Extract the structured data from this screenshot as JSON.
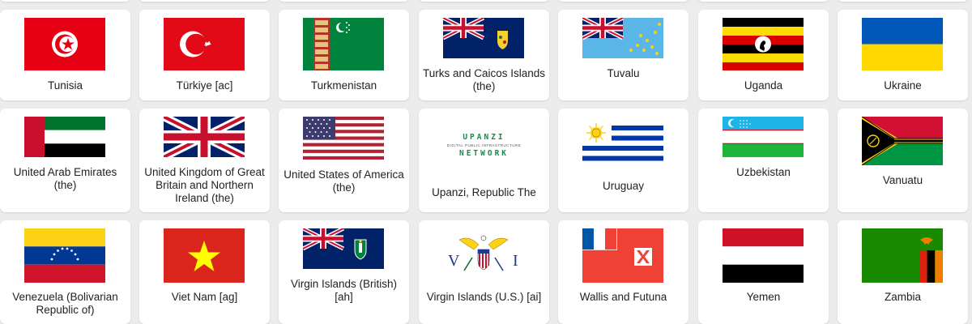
{
  "countries": [
    {
      "name": "Tunisia",
      "flag": "tunisia-flag"
    },
    {
      "name": "Türkiye [ac]",
      "flag": "turkiye-flag"
    },
    {
      "name": "Turkmenistan",
      "flag": "turkmenistan-flag"
    },
    {
      "name": "Turks and Caicos Islands (the)",
      "flag": "turks-caicos-flag"
    },
    {
      "name": "Tuvalu",
      "flag": "tuvalu-flag"
    },
    {
      "name": "Uganda",
      "flag": "uganda-flag"
    },
    {
      "name": "Ukraine",
      "flag": "ukraine-flag"
    },
    {
      "name": "United Arab Emirates (the)",
      "flag": "uae-flag"
    },
    {
      "name": "United Kingdom of Great Britain and Northern Ireland (the)",
      "flag": "uk-flag"
    },
    {
      "name": "United States of America (the)",
      "flag": "usa-flag"
    },
    {
      "name": "Upanzi, Republic The",
      "flag": "upanzi-logo"
    },
    {
      "name": "Uruguay",
      "flag": "uruguay-flag"
    },
    {
      "name": "Uzbekistan",
      "flag": "uzbekistan-flag"
    },
    {
      "name": "Vanuatu",
      "flag": "vanuatu-flag"
    },
    {
      "name": "Venezuela (Bolivarian Republic of)",
      "flag": "venezuela-flag"
    },
    {
      "name": "Viet Nam [ag]",
      "flag": "vietnam-flag"
    },
    {
      "name": "Virgin Islands (British) [ah]",
      "flag": "bvi-flag"
    },
    {
      "name": "Virgin Islands (U.S.) [ai]",
      "flag": "usvi-flag"
    },
    {
      "name": "Wallis and Futuna",
      "flag": "wallis-futuna-flag"
    },
    {
      "name": "Yemen",
      "flag": "yemen-flag"
    },
    {
      "name": "Zambia",
      "flag": "zambia-flag"
    }
  ],
  "upanzi_logo": {
    "top": "UPANZI",
    "middle": "DIGITAL PUBLIC INFRASTRUCTURE",
    "bottom": "NETWORK"
  }
}
